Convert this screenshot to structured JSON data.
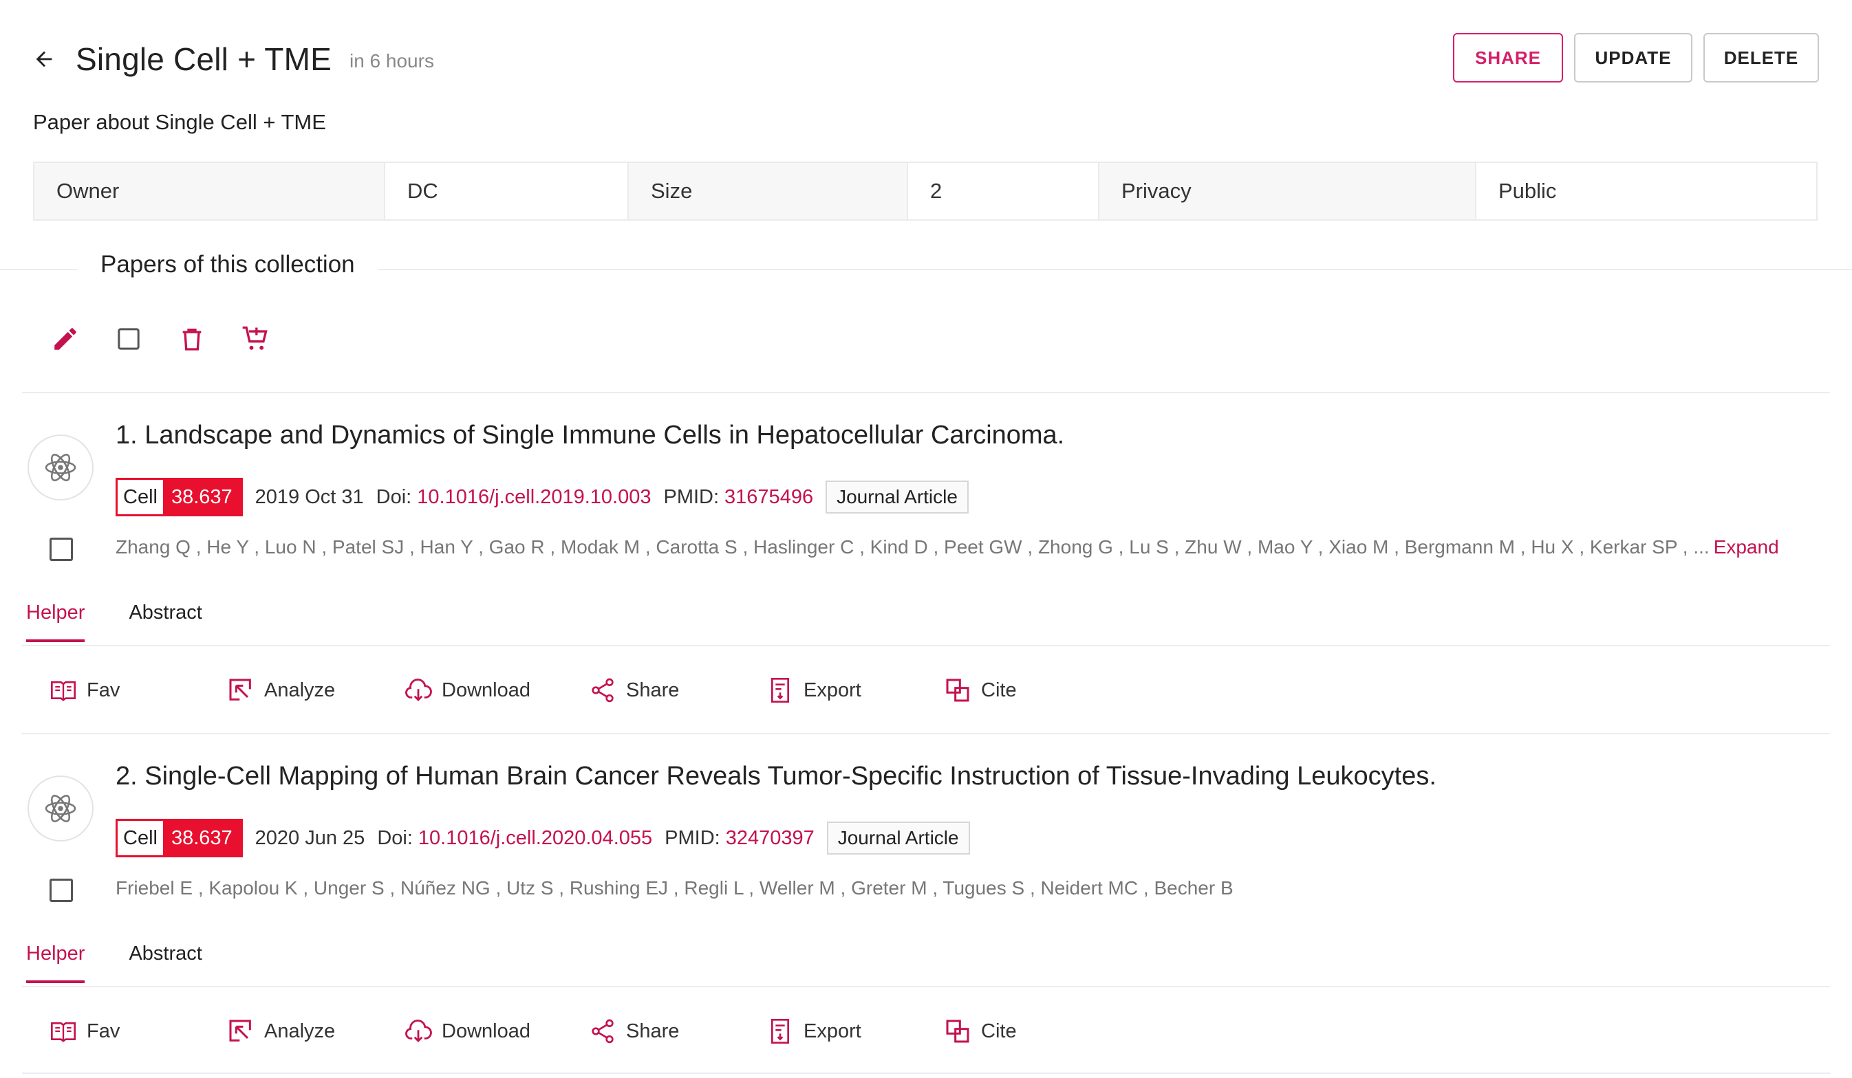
{
  "header": {
    "title": "Single Cell + TME",
    "subtitle": "in 6 hours",
    "back_icon": "arrow-left-icon"
  },
  "actions": {
    "share": "SHARE",
    "update": "UPDATE",
    "delete": "DELETE"
  },
  "description": "Paper about Single Cell + TME",
  "meta": {
    "owner_key": "Owner",
    "owner_value": "DC",
    "size_key": "Size",
    "size_value": "2",
    "privacy_key": "Privacy",
    "privacy_value": "Public"
  },
  "section_title": "Papers of this collection",
  "toolbar_icons": [
    "edit-icon",
    "select-all-checkbox",
    "trash-icon",
    "add-to-cart-icon"
  ],
  "colors": {
    "accent": "#c4124d",
    "journal_red": "#e8102e"
  },
  "papers": [
    {
      "title": "1. Landscape and Dynamics of Single Immune Cells in Hepatocellular Carcinoma.",
      "journal": "Cell",
      "impact": "38.637",
      "date": "2019 Oct 31",
      "doi_label": "Doi:",
      "doi": "10.1016/j.cell.2019.10.003",
      "pmid_label": "PMID:",
      "pmid": "31675496",
      "type": "Journal Article",
      "authors": "Zhang Q , He Y , Luo N , Patel SJ , Han Y , Gao R , Modak M , Carotta S , Haslinger C , Kind D , Peet GW , Zhong G , Lu S , Zhu W , Mao Y , Xiao M , Bergmann M , Hu X , Kerkar SP , ...",
      "expand": "Expand",
      "tabs": [
        "Helper",
        "Abstract"
      ],
      "helpers": [
        "Fav",
        "Analyze",
        "Download",
        "Share",
        "Export",
        "Cite"
      ]
    },
    {
      "title": "2. Single-Cell Mapping of Human Brain Cancer Reveals Tumor-Specific Instruction of Tissue-Invading Leukocytes.",
      "journal": "Cell",
      "impact": "38.637",
      "date": "2020 Jun 25",
      "doi_label": "Doi:",
      "doi": "10.1016/j.cell.2020.04.055",
      "pmid_label": "PMID:",
      "pmid": "32470397",
      "type": "Journal Article",
      "authors": "Friebel E , Kapolou K , Unger S , Núñez NG , Utz S , Rushing EJ , Regli L , Weller M , Greter M , Tugues S , Neidert MC , Becher B",
      "tabs": [
        "Helper",
        "Abstract"
      ],
      "helpers": [
        "Fav",
        "Analyze",
        "Download",
        "Share",
        "Export",
        "Cite"
      ]
    }
  ]
}
